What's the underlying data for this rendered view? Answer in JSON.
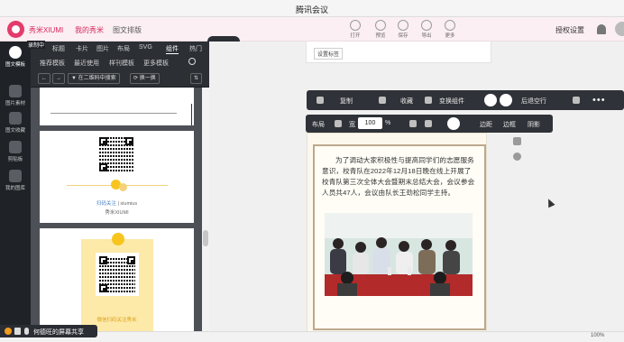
{
  "window": {
    "title": "腾讯会议"
  },
  "header": {
    "brand": "秀米XIUMI",
    "my_xiumi": "我的秀米",
    "layout": "图文排版",
    "tools": [
      "打开",
      "预览",
      "保存",
      "导出",
      "更多"
    ],
    "auth": "授权设置"
  },
  "rail": {
    "items": [
      "图文模板",
      "图片素材",
      "图文收藏",
      "剪贴板",
      "我的图库"
    ]
  },
  "left_panel": {
    "screen_share_label": "录制中",
    "tabs": [
      "标题",
      "卡片",
      "图片",
      "布局",
      "SVG",
      "组件",
      "热门"
    ],
    "active_tab": "组件",
    "subtabs": [
      "推荐模板",
      "最近使用",
      "样刊模板",
      "更多模板"
    ],
    "tool_buttons": [
      "在二维码中搜索",
      "换一换"
    ],
    "clear_label": "清除",
    "card1": {
      "name_label": "秀米XIUMI",
      "line1": "扫码关注",
      "id": "xiumius"
    },
    "card2": {
      "caption": "微信扫码关注秀米"
    }
  },
  "canvas": {
    "page_button": "设置标签",
    "toolbar1": [
      "复制",
      "收藏",
      "变换组件",
      "后退空行"
    ],
    "toolbar2": [
      "布局",
      "宽",
      "%",
      "边距",
      "边框",
      "阴影"
    ],
    "width_value": "100",
    "article_text": "为了调动大家积极性与提高同学们的志愿服务意识，校青队在2022年12月18日晚在线上开展了校青队第三次全体大会暨期末总结大会，会议参会人员共47人，会议由队长王劲松同学主持。"
  },
  "footer": {
    "share_text": "何德旺的屏幕共享",
    "zoom": "100%"
  },
  "colors": {
    "brand": "#d8285d",
    "accent_yellow": "#f7c51e",
    "toolbar_bg": "#2f3238",
    "rail_bg": "#1f2227"
  }
}
